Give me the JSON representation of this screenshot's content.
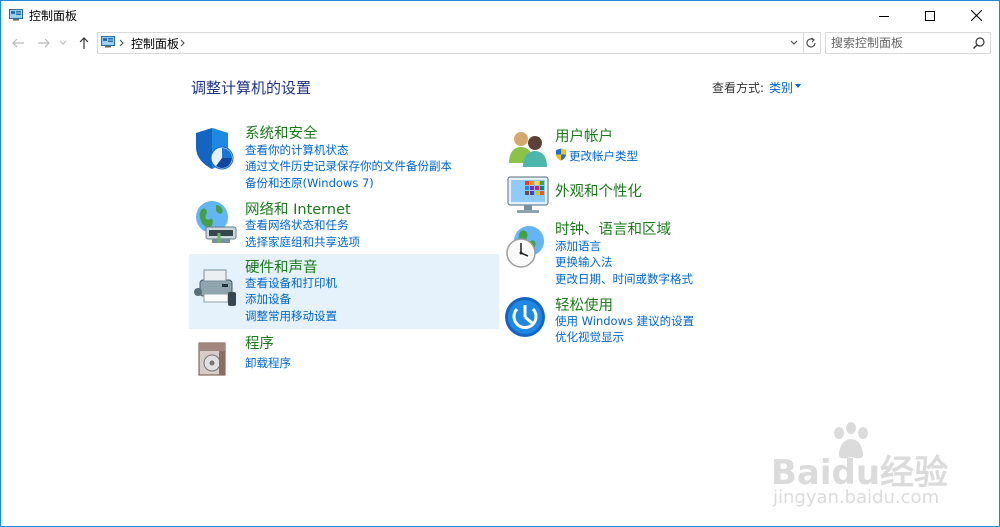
{
  "window": {
    "title": "控制面板"
  },
  "address": {
    "path": "控制面板",
    "search_placeholder": "搜索控制面板"
  },
  "main": {
    "heading": "调整计算机的设置",
    "view_by_label": "查看方式:",
    "view_by_value": "类别"
  },
  "categories": [
    {
      "title": "系统和安全",
      "links": [
        "查看你的计算机状态",
        "通过文件历史记录保存你的文件备份副本",
        "备份和还原(Windows 7)"
      ]
    },
    {
      "title": "网络和 Internet",
      "links": [
        "查看网络状态和任务",
        "选择家庭组和共享选项"
      ]
    },
    {
      "title": "硬件和声音",
      "links": [
        "查看设备和打印机",
        "添加设备",
        "调整常用移动设置"
      ]
    },
    {
      "title": "程序",
      "links": [
        "卸载程序"
      ]
    },
    {
      "title": "用户帐户",
      "links": [
        "更改帐户类型"
      ]
    },
    {
      "title": "外观和个性化",
      "links": []
    },
    {
      "title": "时钟、语言和区域",
      "links": [
        "添加语言",
        "更换输入法",
        "更改日期、时间或数字格式"
      ]
    },
    {
      "title": "轻松使用",
      "links": [
        "使用 Windows 建议的设置",
        "优化视觉显示"
      ]
    }
  ],
  "watermark": {
    "logo": "Baidu经验",
    "url": "jingyan.baidu.com"
  },
  "colors": {
    "category_title": "#1a7a1a",
    "link": "#0066cc",
    "heading": "#1e3287",
    "highlight": "#e5f1fb",
    "window_border": "#1d8ad6"
  }
}
